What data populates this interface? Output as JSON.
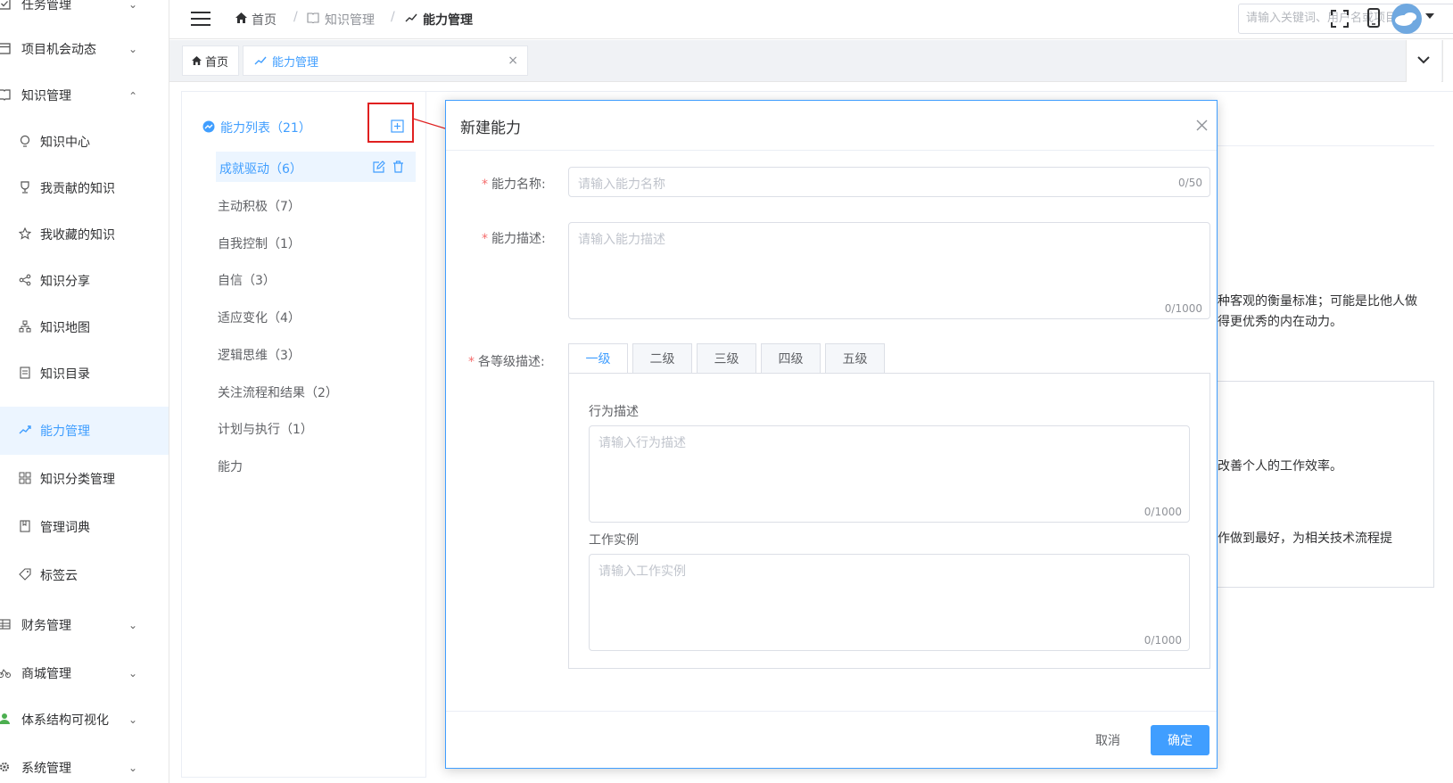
{
  "sidebar": {
    "items": [
      {
        "label": "任务管理",
        "icon": "checkbox-icon",
        "expandable": true
      },
      {
        "label": "项目机会动态",
        "icon": "calendar-icon",
        "expandable": true
      },
      {
        "label": "知识管理",
        "icon": "book-icon",
        "expandable": true,
        "expanded": true
      },
      {
        "label": "知识中心",
        "icon": "bulb-icon"
      },
      {
        "label": "我贡献的知识",
        "icon": "trophy-icon"
      },
      {
        "label": "我收藏的知识",
        "icon": "star-icon"
      },
      {
        "label": "知识分享",
        "icon": "share-icon"
      },
      {
        "label": "知识地图",
        "icon": "sitemap-icon"
      },
      {
        "label": "知识目录",
        "icon": "list-icon"
      },
      {
        "label": "能力管理",
        "icon": "trend-icon",
        "active": true
      },
      {
        "label": "知识分类管理",
        "icon": "grid-icon"
      },
      {
        "label": "管理词典",
        "icon": "dictionary-icon"
      },
      {
        "label": "标签云",
        "icon": "tag-icon"
      },
      {
        "label": "财务管理",
        "icon": "table-icon",
        "expandable": true
      },
      {
        "label": "商城管理",
        "icon": "bike-icon",
        "expandable": true
      },
      {
        "label": "体系结构可视化",
        "icon": "person-icon",
        "expandable": true
      },
      {
        "label": "系统管理",
        "icon": "gear-icon",
        "expandable": true
      }
    ]
  },
  "header": {
    "breadcrumb": [
      "首页",
      "知识管理",
      "能力管理"
    ],
    "search_placeholder": "请输入关键词、用户名或项目代号"
  },
  "tabs": {
    "home": "首页",
    "current": "能力管理"
  },
  "tree": {
    "root": "能力列表（21）",
    "nodes": [
      "成就驱动（6）",
      "主动积极（7）",
      "自我控制（1）",
      "自信（3）",
      "适应变化（4）",
      "逻辑思维（3）",
      "关注流程和结果（2）",
      "计划与执行（1）",
      "能力"
    ]
  },
  "background_text": {
    "line1": "种客观的衡量标准；可能是比他人做",
    "line2": "得更优秀的内在动力。",
    "line3": "改善个人的工作效率。",
    "line4": "作做到最好，为相关技术流程提"
  },
  "modal": {
    "title": "新建能力",
    "name_label": "能力名称:",
    "name_placeholder": "请输入能力名称",
    "name_count": "0/50",
    "desc_label": "能力描述:",
    "desc_placeholder": "请输入能力描述",
    "desc_count": "0/1000",
    "levels_label": "各等级描述:",
    "level_tabs": [
      "一级",
      "二级",
      "三级",
      "四级",
      "五级"
    ],
    "behavior_label": "行为描述",
    "behavior_placeholder": "请输入行为描述",
    "behavior_count": "0/1000",
    "example_label": "工作实例",
    "example_placeholder": "请输入工作实例",
    "example_count": "0/1000",
    "cancel": "取消",
    "confirm": "确定"
  },
  "colors": {
    "accent": "#409eff",
    "highlight_box": "#e02020",
    "required": "#f56c6c"
  }
}
